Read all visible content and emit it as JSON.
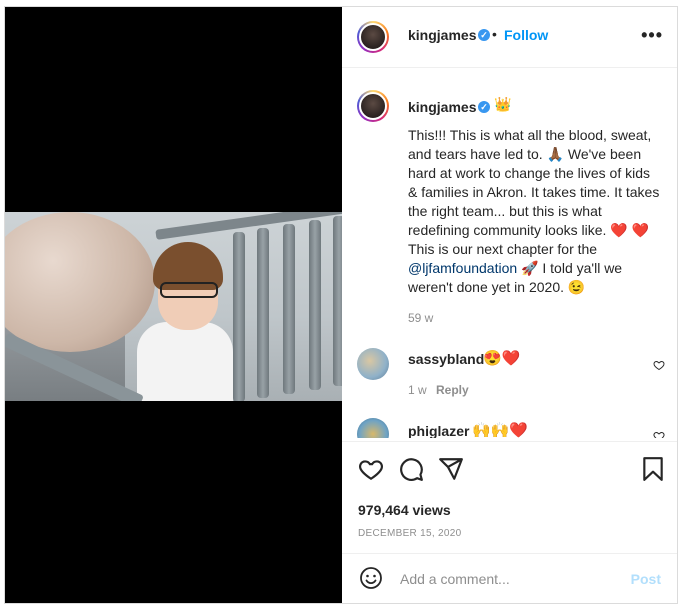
{
  "post": {
    "username": "kingjames",
    "follow_label": "Follow",
    "dot": "•",
    "more": "•••"
  },
  "caption": {
    "username": "kingjames",
    "crown": "👑",
    "text_1": "This!!! This is what all the blood, sweat, and tears have led to.",
    "emoji_pray": "🙏🏾",
    "text_2": "We've been hard at work to change the lives of kids & families in Akron. It takes time. It takes the right team... but this is what redefining community looks like.",
    "hearts": "❤️ ❤️",
    "text_3": "This is our next chapter for the",
    "mention": "@ljfamfoundation",
    "rocket": "🚀",
    "text_4": "I told ya'll we weren't done yet in 2020.",
    "wink": "😉",
    "time": "59 w"
  },
  "comments": [
    {
      "username": "sassybland",
      "text": "😍❤️",
      "time": "1 w",
      "reply_label": "Reply"
    },
    {
      "username": "phiglazer",
      "text": "🙌🙌❤️"
    }
  ],
  "stats": {
    "views": "979,464 views",
    "date": "DECEMBER 15, 2020"
  },
  "add_comment": {
    "placeholder": "Add a comment...",
    "post_label": "Post"
  },
  "colors": {
    "link_blue": "#0095f6",
    "post_disabled": "#b2dffc",
    "heart_red": "#ed1d3b"
  }
}
